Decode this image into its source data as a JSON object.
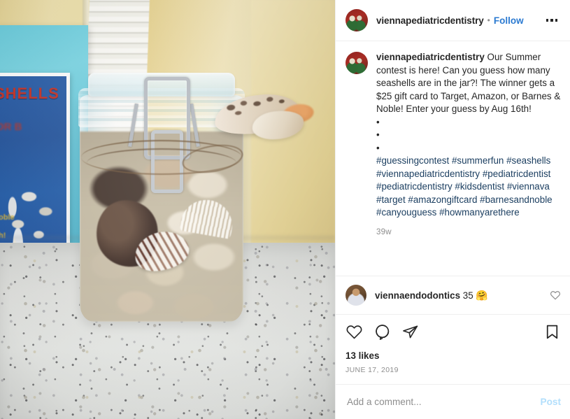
{
  "header": {
    "username": "viennapediatricdentistry",
    "separator": "•",
    "follow_label": "Follow",
    "more_label": "More options"
  },
  "caption": {
    "username": "viennapediatricdentistry",
    "text": "Our Summer contest is here! Can you guess how many seashells are in the jar?! The winner gets a $25 gift card to Target, Amazon, or Barnes & Noble! Enter your guess by Aug 16th!",
    "bullets": "•\n•\n•",
    "bullet_char": "•",
    "hashtags": "#guessingcontest #summerfun #seashells #viennapediatricdentistry #pediatricdentist #pediatricdentistry #kidsdentist #viennava #target #amazongiftcard #barnesandnoble #canyouguess #howmanyarethere",
    "timestamp": "39w"
  },
  "comment": {
    "username": "viennaendodontics",
    "text": "35",
    "emoji": "🤗"
  },
  "actions": {
    "like_icon": "heart-icon",
    "comment_icon": "comment-icon",
    "share_icon": "share-icon",
    "save_icon": "bookmark-icon",
    "likes": "13 likes",
    "date": "JUNE 17, 2019"
  },
  "add_comment": {
    "placeholder": "Add a comment...",
    "value": "",
    "post_label": "Post"
  },
  "media": {
    "alt": "Glass jar filled with seashells on a speckled countertop",
    "poster_title": "SHELLS",
    "poster_sub": "OR B",
    "poster_sub2": "oble",
    "poster_sub3": "h!"
  },
  "colors": {
    "follow_blue": "#2b7ad1",
    "hashtag_blue": "#1c3f61",
    "text_primary": "#262626",
    "text_secondary": "#8e8e8e",
    "post_disabled": "#b2dffc",
    "border": "#efefef"
  }
}
